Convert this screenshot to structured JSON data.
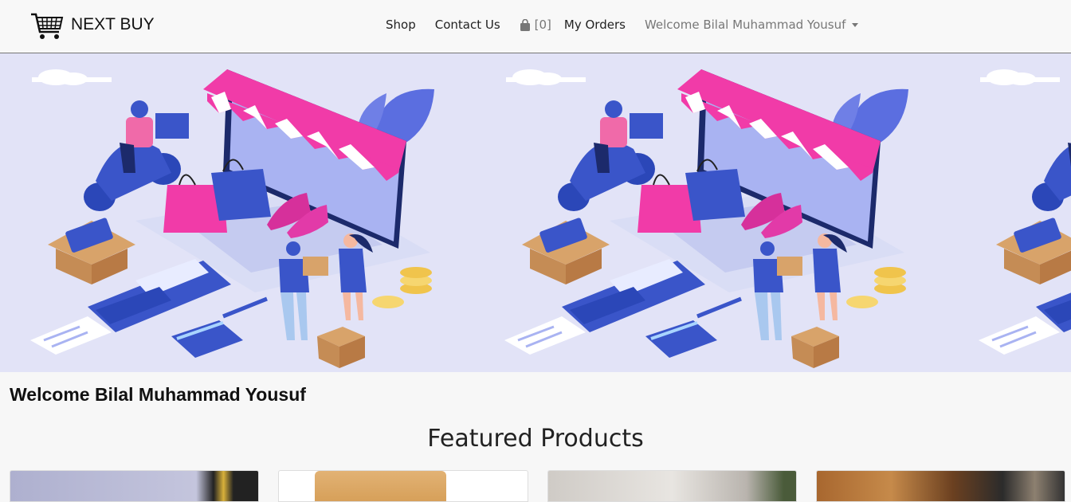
{
  "brand": {
    "name": "NEXT BUY",
    "icon": "shopping-cart-icon"
  },
  "nav": {
    "shop": "Shop",
    "contact": "Contact Us",
    "cart_count": "[0]",
    "cart_icon": "shopping-bag-icon",
    "orders": "My Orders",
    "user_menu": "Welcome Bilal Muhammad Yousuf"
  },
  "main": {
    "welcome": "Welcome Bilal Muhammad Yousuf",
    "featured_title": "Featured Products"
  },
  "colors": {
    "hero_bg": "#e2e3f7",
    "accent_pink": "#f13ba8",
    "accent_blue": "#3a55c9"
  }
}
